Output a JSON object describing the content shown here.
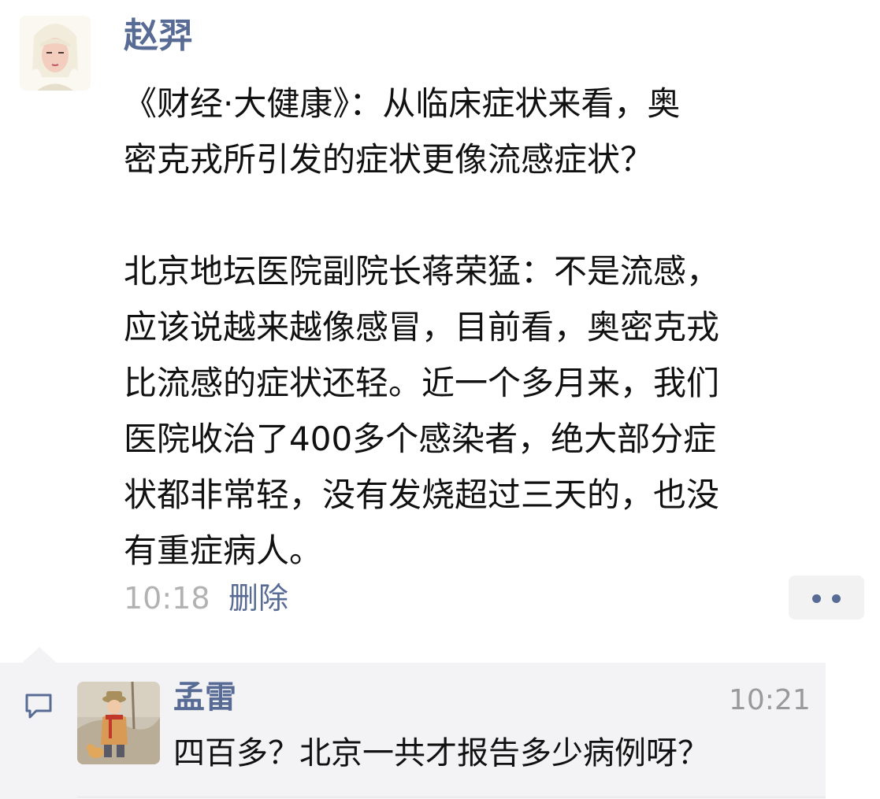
{
  "post": {
    "author_name": "赵羿",
    "text": "《财经·大健康》：从临床症状来看，奥\n密克戎所引发的症状更像流感症状？\n\n北京地坛医院副院长蒋荣猛：不是流感，\n应该说越来越像感冒，目前看，奥密克戎\n比流感的症状还轻。近一个多月来，我们\n医院收治了400多个感染者，绝大部分症\n状都非常轻，没有发烧超过三天的，也没\n有重症病人。",
    "time": "10:18",
    "delete_label": "删除",
    "more_icon": "two-dots-icon"
  },
  "comments": [
    {
      "author_name": "孟雷",
      "time": "10:21",
      "text": "四百多？北京一共才报告多少病例呀？"
    }
  ],
  "colors": {
    "link": "#576b95",
    "text": "#111111",
    "meta": "#b2b2b2",
    "comment_bg": "#f3f3f5"
  }
}
